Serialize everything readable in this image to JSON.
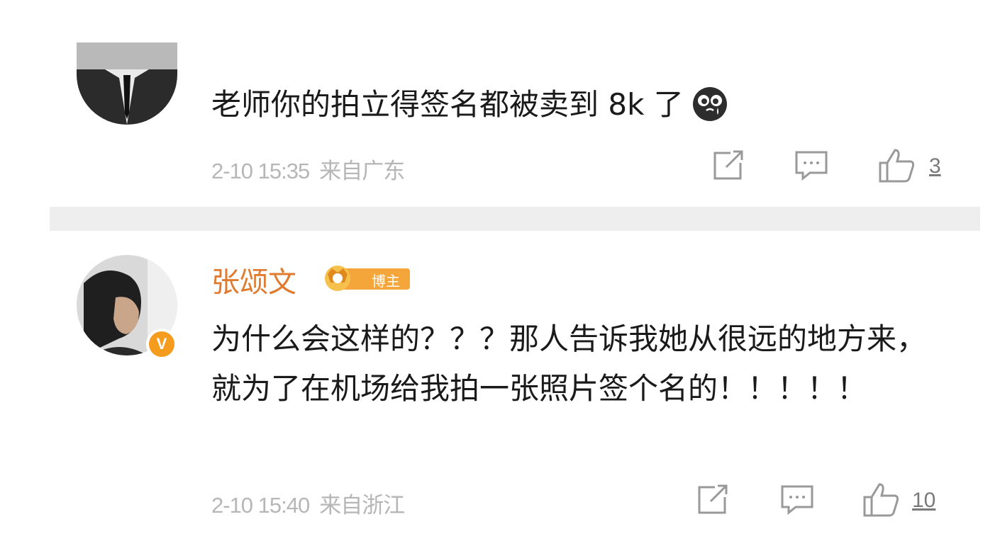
{
  "comments": [
    {
      "text": "老师你的拍立得签名都被卖到 8k 了",
      "emoji": "crying-face-emoji",
      "time": "2-10 15:35",
      "location": "来自广东",
      "likes": "3"
    },
    {
      "user": "张颂文",
      "badge_label": "博主",
      "text": "为什么会这样的？？？那人告诉我她从很远的地方来，就为了在机场给我拍一张照片签个名的！！！！！",
      "time": "2-10 15:40",
      "location": "来自浙江",
      "likes": "10"
    }
  ],
  "icons": {
    "repost": "share-icon",
    "comment": "comment-icon",
    "like": "thumbs-up-icon",
    "verified": "verified-v-icon"
  },
  "colors": {
    "username": "#e07a2e",
    "verified_badge": "#f59b1d",
    "meta_text": "#b6b6b6",
    "divider": "#eeeeee"
  }
}
